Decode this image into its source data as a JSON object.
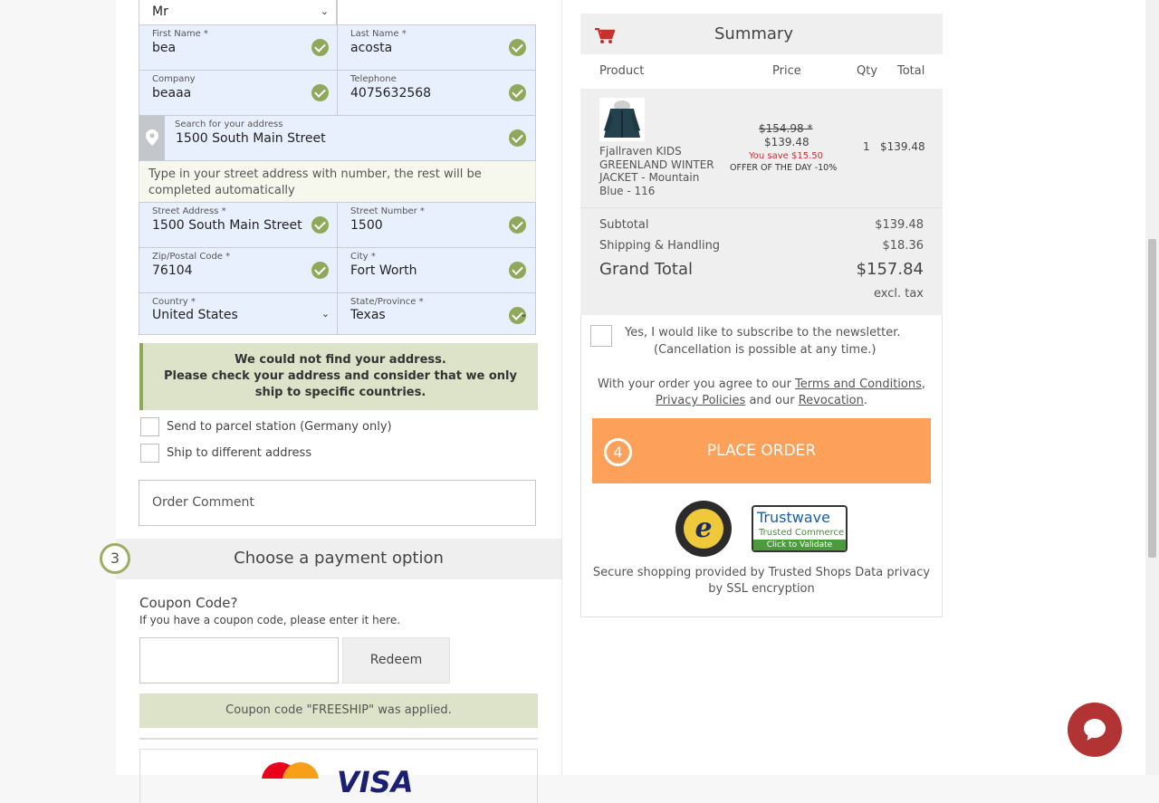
{
  "form": {
    "salutation": "Mr",
    "first_name": {
      "label": "First Name *",
      "value": "bea"
    },
    "last_name": {
      "label": "Last Name *",
      "value": "acosta"
    },
    "company": {
      "label": "Company",
      "value": "beaaa"
    },
    "telephone": {
      "label": "Telephone",
      "value": "4075632568"
    },
    "address_search": {
      "label": "Search for your address",
      "value": "1500 South Main Street"
    },
    "address_hint": "Type in your street address with number, the rest will be completed automatically",
    "street_address": {
      "label": "Street Address *",
      "value": "1500 South Main Street"
    },
    "street_number": {
      "label": "Street Number *",
      "value": "1500"
    },
    "zip": {
      "label": "Zip/Postal Code *",
      "value": "76104"
    },
    "city": {
      "label": "City *",
      "value": "Fort Worth"
    },
    "country": {
      "label": "Country *",
      "value": "United States"
    },
    "state": {
      "label": "State/Province *",
      "value": "Texas"
    },
    "alert_line1": "We could not find your address.",
    "alert_line2": "Please check your address and consider that we only ship to specific countries.",
    "parcel_station_label": "Send to parcel station (Germany only)",
    "ship_different_label": "Ship to different address",
    "order_comment_placeholder": "Order Comment"
  },
  "payment": {
    "step_number": "3",
    "title": "Choose a payment option",
    "coupon_title": "Coupon Code?",
    "coupon_hint": "If you have a coupon code, please enter it here.",
    "coupon_value": "",
    "redeem_label": "Redeem",
    "coupon_applied": "Coupon code \"FREESHIP\" was applied."
  },
  "summary": {
    "title": "Summary",
    "headers": {
      "product": "Product",
      "price": "Price",
      "qty": "Qty",
      "total": "Total"
    },
    "item": {
      "name": "Fjallraven KIDS GREENLAND WINTER JACKET - Mountain Blue - 116",
      "old_price": "$154.98 *",
      "price": "$139.48",
      "savings": "You save $15.50",
      "offer": "OFFER OF THE DAY -10%",
      "qty": "1",
      "total": "$139.48"
    },
    "subtotal_label": "Subtotal",
    "subtotal_value": "$139.48",
    "shipping_label": "Shipping & Handling",
    "shipping_value": "$18.36",
    "grand_total_label": "Grand Total",
    "grand_total_value": "$157.84",
    "tax_note": "excl. tax",
    "newsletter_line1": "Yes, I would like to subscribe to the newsletter.",
    "newsletter_line2": "(Cancellation is possible at any time.)",
    "agree_prefix": "With your order you agree to our",
    "terms_link": "Terms and Conditions",
    "privacy_link": "Privacy Policies",
    "agree_and": "and our",
    "revocation_link": "Revocation",
    "place_order_step": "4",
    "place_order_label": "PLACE ORDER",
    "trust_line": "Secure shopping provided by Trusted Shops Data privacy by SSL encryption",
    "trustwave_title": "Trustwave",
    "trustwave_sub": "Trusted Commerce",
    "trustwave_cta": "Click to Validate",
    "trusted_shops_ring": "TRUSTED SHOPS GUARANTEE",
    "trusted_shops_letter": "e",
    "visa_text": "VISA"
  },
  "colors": {
    "accent_orange": "#fca05a",
    "check_green": "#8fa95b",
    "alert_bg": "#dde3c8",
    "field_bg": "#e8f0fe",
    "cart_red": "#c9302c",
    "chat_red": "#b23333"
  }
}
